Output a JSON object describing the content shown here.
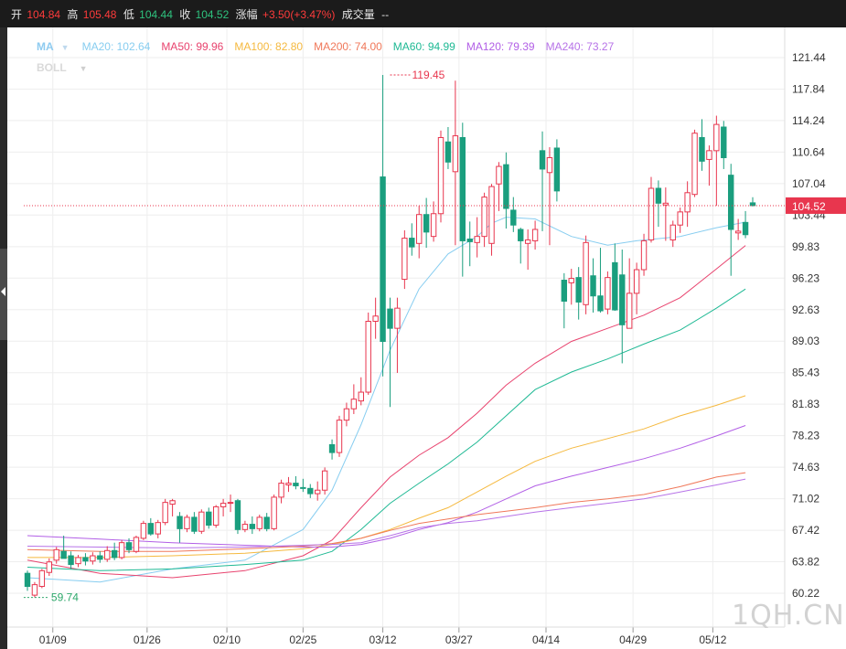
{
  "topbar": {
    "open_label": "开",
    "open": "104.84",
    "high_label": "高",
    "high": "105.48",
    "low_label": "低",
    "low": "104.44",
    "close_label": "收",
    "close": "104.52",
    "change_label": "涨幅",
    "change": "+3.50(+3.47%)",
    "volume_label": "成交量",
    "volume": "--"
  },
  "legend": {
    "title": "MA",
    "items": [
      {
        "text": "MA20: 102.64",
        "color": "#87cdf0"
      },
      {
        "text": "MA50: 99.96",
        "color": "#e8436e"
      },
      {
        "text": "MA100: 82.80",
        "color": "#f5b93f"
      },
      {
        "text": "MA200: 74.00",
        "color": "#f0785a"
      },
      {
        "text": "MA60: 94.99",
        "color": "#1fb994"
      },
      {
        "text": "MA120: 79.39",
        "color": "#b25fe6"
      },
      {
        "text": "MA240: 73.27",
        "color": "#b773e8"
      }
    ],
    "boll_label": "BOLL"
  },
  "watermark": "1QH.CN",
  "colors": {
    "up": "#e8364e",
    "down": "#1a9e7e",
    "grid": "#eeeeee"
  },
  "chart_data": {
    "type": "candlestick",
    "ylim": [
      58.6,
      124.0
    ],
    "y_ticks": [
      "121.44",
      "117.84",
      "114.24",
      "110.64",
      "107.04",
      "103.44",
      "99.83",
      "96.23",
      "92.63",
      "89.03",
      "85.43",
      "81.83",
      "78.23",
      "74.63",
      "71.02",
      "67.42",
      "63.82",
      "60.22"
    ],
    "x_ticks": [
      "01/09",
      "01/26",
      "02/10",
      "02/25",
      "03/12",
      "03/27",
      "04/14",
      "04/29",
      "05/12"
    ],
    "x_tick_index": [
      3.5,
      16.5,
      27.5,
      38,
      49,
      59.5,
      71.5,
      83.5,
      94.5
    ],
    "current_price": 104.52,
    "current_price_label": "104.52",
    "max_annotation": {
      "index": 50,
      "value": 119.45,
      "label": "119.45"
    },
    "min_annotation": {
      "index": 1,
      "value": 59.74,
      "label": "59.74"
    },
    "ohlc": [
      [
        62.5,
        62.8,
        60.5,
        61.0
      ],
      [
        60.0,
        61.5,
        59.74,
        61.2
      ],
      [
        61.0,
        63.0,
        60.8,
        62.8
      ],
      [
        62.6,
        64.2,
        62.2,
        63.8
      ],
      [
        64.0,
        65.5,
        63.6,
        65.2
      ],
      [
        65.0,
        66.8,
        64.8,
        64.2
      ],
      [
        64.5,
        65.0,
        63.0,
        63.5
      ],
      [
        63.6,
        64.6,
        63.2,
        64.3
      ],
      [
        64.3,
        64.8,
        63.4,
        63.9
      ],
      [
        63.9,
        64.9,
        63.5,
        64.5
      ],
      [
        64.5,
        65.0,
        63.7,
        64.1
      ],
      [
        64.1,
        65.6,
        63.8,
        65.1
      ],
      [
        65.1,
        66.0,
        64.0,
        64.3
      ],
      [
        64.3,
        66.3,
        64.1,
        66.0
      ],
      [
        66.0,
        66.5,
        64.8,
        65.2
      ],
      [
        65.0,
        66.8,
        64.8,
        66.6
      ],
      [
        66.5,
        68.5,
        66.3,
        68.2
      ],
      [
        68.2,
        68.8,
        66.8,
        67.0
      ],
      [
        67.0,
        68.6,
        66.5,
        68.3
      ],
      [
        68.3,
        71.0,
        68.0,
        70.6
      ],
      [
        70.4,
        71.0,
        69.0,
        70.8
      ],
      [
        69.0,
        69.5,
        66.0,
        67.6
      ],
      [
        67.6,
        69.2,
        67.2,
        68.9
      ],
      [
        68.9,
        69.5,
        67.0,
        67.3
      ],
      [
        67.3,
        69.8,
        67.0,
        69.5
      ],
      [
        69.5,
        70.0,
        67.6,
        68.0
      ],
      [
        68.0,
        70.3,
        67.7,
        70.1
      ],
      [
        70.1,
        71.0,
        69.0,
        70.5
      ],
      [
        70.5,
        71.5,
        69.5,
        70.6
      ],
      [
        70.8,
        71.0,
        67.0,
        67.5
      ],
      [
        67.5,
        68.5,
        67.2,
        68.1
      ],
      [
        68.1,
        69.0,
        67.0,
        67.6
      ],
      [
        67.6,
        69.2,
        67.3,
        68.9
      ],
      [
        68.9,
        69.4,
        67.3,
        67.6
      ],
      [
        67.6,
        71.5,
        67.4,
        71.2
      ],
      [
        71.2,
        73.2,
        70.5,
        72.8
      ],
      [
        72.6,
        73.5,
        71.8,
        72.8
      ],
      [
        72.8,
        73.6,
        72.1,
        72.5
      ],
      [
        72.3,
        73.3,
        71.8,
        72.2
      ],
      [
        72.2,
        72.7,
        71.1,
        71.6
      ],
      [
        71.6,
        73.0,
        70.8,
        72.0
      ],
      [
        72.0,
        74.6,
        71.5,
        74.2
      ],
      [
        77.2,
        77.8,
        75.5,
        76.3
      ],
      [
        76.3,
        80.5,
        75.8,
        80.0
      ],
      [
        80.0,
        82.0,
        79.3,
        81.3
      ],
      [
        81.3,
        84.1,
        80.7,
        82.4
      ],
      [
        82.2,
        84.9,
        81.7,
        83.2
      ],
      [
        83.2,
        92.3,
        82.9,
        91.3
      ],
      [
        91.3,
        94.0,
        89.3,
        91.9
      ],
      [
        107.8,
        119.45,
        85.0,
        89.0
      ],
      [
        92.7,
        94.0,
        81.5,
        90.5
      ],
      [
        90.5,
        94.0,
        85.4,
        92.8
      ],
      [
        96.1,
        101.7,
        95.0,
        100.8
      ],
      [
        100.8,
        102.5,
        98.8,
        99.8
      ],
      [
        100.2,
        104.5,
        98.5,
        103.5
      ],
      [
        103.5,
        105.4,
        99.7,
        101.5
      ],
      [
        101.0,
        105.0,
        100.4,
        103.6
      ],
      [
        103.6,
        113.1,
        102.6,
        112.3
      ],
      [
        111.8,
        113.5,
        108.7,
        109.5
      ],
      [
        108.4,
        118.8,
        100.0,
        112.5
      ],
      [
        112.3,
        114.0,
        96.4,
        100.5
      ],
      [
        100.7,
        102.7,
        97.6,
        100.4
      ],
      [
        100.3,
        103.2,
        98.6,
        101.0
      ],
      [
        101.0,
        106.0,
        99.8,
        105.5
      ],
      [
        100.2,
        107.0,
        98.8,
        106.7
      ],
      [
        107.0,
        109.5,
        103.9,
        109.0
      ],
      [
        109.2,
        110.6,
        101.9,
        104.2
      ],
      [
        104.0,
        105.5,
        101.5,
        102.3
      ],
      [
        101.8,
        102.0,
        97.9,
        100.5
      ],
      [
        100.2,
        101.8,
        97.2,
        100.6
      ],
      [
        100.5,
        102.8,
        99.5,
        101.8
      ],
      [
        110.8,
        113.0,
        101.6,
        108.7
      ],
      [
        108.3,
        111.2,
        100.0,
        110.0
      ],
      [
        111.1,
        112.1,
        105.0,
        106.2
      ],
      [
        96.0,
        96.8,
        90.5,
        93.6
      ],
      [
        95.7,
        97.3,
        93.2,
        96.2
      ],
      [
        96.3,
        97.5,
        91.5,
        93.5
      ],
      [
        93.2,
        101.1,
        92.1,
        100.3
      ],
      [
        96.5,
        98.5,
        92.3,
        94.2
      ],
      [
        94.2,
        99.7,
        92.3,
        92.5
      ],
      [
        92.7,
        97.0,
        92.1,
        96.3
      ],
      [
        98.0,
        100.2,
        92.5,
        92.6
      ],
      [
        96.6,
        99.5,
        86.5,
        90.9
      ],
      [
        90.5,
        98.5,
        92.3,
        94.5
      ],
      [
        94.5,
        98.0,
        92.1,
        97.2
      ],
      [
        97.2,
        101.3,
        96.5,
        100.5
      ],
      [
        100.6,
        107.8,
        100.3,
        106.5
      ],
      [
        106.5,
        107.4,
        102.1,
        104.8
      ],
      [
        104.6,
        106.6,
        100.5,
        104.8
      ],
      [
        100.6,
        102.8,
        99.8,
        102.3
      ],
      [
        102.3,
        104.3,
        101.4,
        103.8
      ],
      [
        103.8,
        107.3,
        102.1,
        106.0
      ],
      [
        105.8,
        113.2,
        105.5,
        112.8
      ],
      [
        112.3,
        114.4,
        108.5,
        109.6
      ],
      [
        109.8,
        111.4,
        106.8,
        110.8
      ],
      [
        110.8,
        114.8,
        104.5,
        113.8
      ],
      [
        113.5,
        114.2,
        108.7,
        110.0
      ],
      [
        108.0,
        109.3,
        96.5,
        101.8
      ],
      [
        101.4,
        103.0,
        100.6,
        101.6
      ],
      [
        102.6,
        103.9,
        100.8,
        101.2
      ],
      [
        104.84,
        105.48,
        104.44,
        104.52
      ]
    ],
    "series": [
      {
        "name": "MA20",
        "color": "#87cdf0",
        "x": [
          0,
          10,
          20,
          30,
          38,
          42,
          46,
          50,
          54,
          58,
          62,
          64,
          66,
          70,
          75,
          80,
          84,
          90,
          95,
          99
        ],
        "y": [
          62.0,
          61.5,
          63.0,
          64.0,
          67.5,
          72.0,
          79.5,
          88.0,
          95.0,
          99.0,
          101.0,
          102.5,
          103.2,
          103.0,
          101.0,
          100.0,
          100.5,
          101.0,
          102.0,
          102.64
        ]
      },
      {
        "name": "MA50",
        "color": "#e8436e",
        "x": [
          0,
          10,
          20,
          30,
          38,
          42,
          46,
          50,
          54,
          58,
          62,
          66,
          70,
          75,
          80,
          85,
          90,
          95,
          99
        ],
        "y": [
          64.0,
          62.5,
          62.0,
          62.8,
          64.5,
          66.3,
          70.0,
          73.5,
          76.0,
          78.0,
          80.8,
          84.0,
          86.5,
          89.0,
          90.5,
          92.0,
          94.0,
          97.3,
          99.96
        ]
      },
      {
        "name": "MA60",
        "color": "#1fb994",
        "x": [
          0,
          10,
          20,
          30,
          38,
          42,
          46,
          50,
          54,
          58,
          62,
          66,
          70,
          75,
          80,
          85,
          90,
          95,
          99
        ],
        "y": [
          63.2,
          62.8,
          63.0,
          63.5,
          64.0,
          65.0,
          67.5,
          70.5,
          72.8,
          75.0,
          77.5,
          80.5,
          83.5,
          85.5,
          87.0,
          88.7,
          90.3,
          92.8,
          94.99
        ]
      },
      {
        "name": "MA100",
        "color": "#f5b93f",
        "x": [
          0,
          10,
          20,
          30,
          38,
          42,
          46,
          50,
          54,
          58,
          62,
          66,
          70,
          75,
          80,
          85,
          90,
          95,
          99
        ],
        "y": [
          64.3,
          64.3,
          64.5,
          64.8,
          65.3,
          65.8,
          66.5,
          67.5,
          68.8,
          70.0,
          71.8,
          73.6,
          75.3,
          76.8,
          77.9,
          79.0,
          80.5,
          81.7,
          82.8
        ]
      },
      {
        "name": "MA120",
        "color": "#b25fe6",
        "x": [
          0,
          10,
          20,
          30,
          38,
          42,
          46,
          50,
          54,
          58,
          62,
          66,
          70,
          75,
          80,
          85,
          90,
          95,
          99
        ],
        "y": [
          66.8,
          66.4,
          66.0,
          65.7,
          65.5,
          65.5,
          65.8,
          66.5,
          67.5,
          68.3,
          69.5,
          71.0,
          72.5,
          73.6,
          74.6,
          75.6,
          76.8,
          78.2,
          79.39
        ]
      },
      {
        "name": "MA200",
        "color": "#f0785a",
        "x": [
          0,
          10,
          20,
          30,
          38,
          42,
          46,
          50,
          54,
          58,
          62,
          66,
          70,
          75,
          80,
          85,
          90,
          95,
          99
        ],
        "y": [
          65.2,
          65.0,
          65.0,
          65.3,
          65.6,
          65.9,
          66.5,
          67.4,
          68.2,
          68.7,
          69.2,
          69.6,
          70.0,
          70.6,
          71.0,
          71.5,
          72.4,
          73.5,
          74.0
        ]
      },
      {
        "name": "MA240",
        "color": "#b773e8",
        "x": [
          0,
          10,
          20,
          30,
          38,
          42,
          46,
          50,
          54,
          58,
          62,
          66,
          70,
          75,
          80,
          85,
          90,
          95,
          99
        ],
        "y": [
          65.6,
          65.5,
          65.4,
          65.5,
          65.7,
          65.8,
          66.0,
          66.8,
          67.7,
          68.2,
          68.5,
          69.0,
          69.5,
          70.0,
          70.5,
          71.0,
          71.8,
          72.6,
          73.27
        ]
      }
    ]
  }
}
